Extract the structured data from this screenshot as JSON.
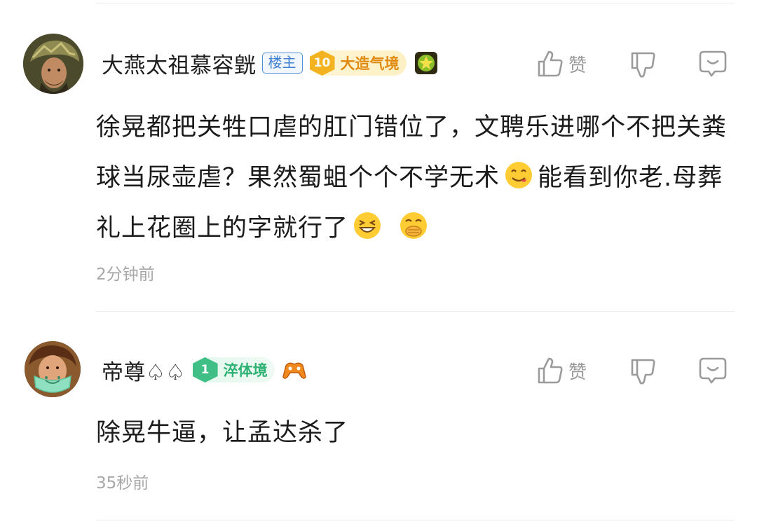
{
  "comments": [
    {
      "username": "大燕太祖慕容皝",
      "owner_badge": "楼主",
      "level_number": "10",
      "level_title": "大造气境",
      "like_label": "赞",
      "text_part1": "徐晃都把关牲口虐的肛门错位了，文聘乐进哪个不把关粪球当尿壶虐？果然蜀蛆个个不学无术",
      "text_part2": "能看到你老.母葬礼上花圈上的字就行了",
      "time": "2分钟前",
      "emojis": [
        "yum-face-icon",
        "grin-squint-icon",
        "face-with-hand-over-mouth-icon"
      ],
      "level_color": "#f3b21f"
    },
    {
      "username": "帝尊♤♤",
      "level_number": "1",
      "level_title": "淬体境",
      "like_label": "赞",
      "text": "除晃牛逼，让孟达杀了",
      "time": "35秒前",
      "level_color": "#3fbf86"
    }
  ],
  "icons": [
    "thumbs-up-icon",
    "thumbs-down-icon",
    "reply-bubble-icon",
    "medal-icon",
    "gamepad-icon"
  ]
}
